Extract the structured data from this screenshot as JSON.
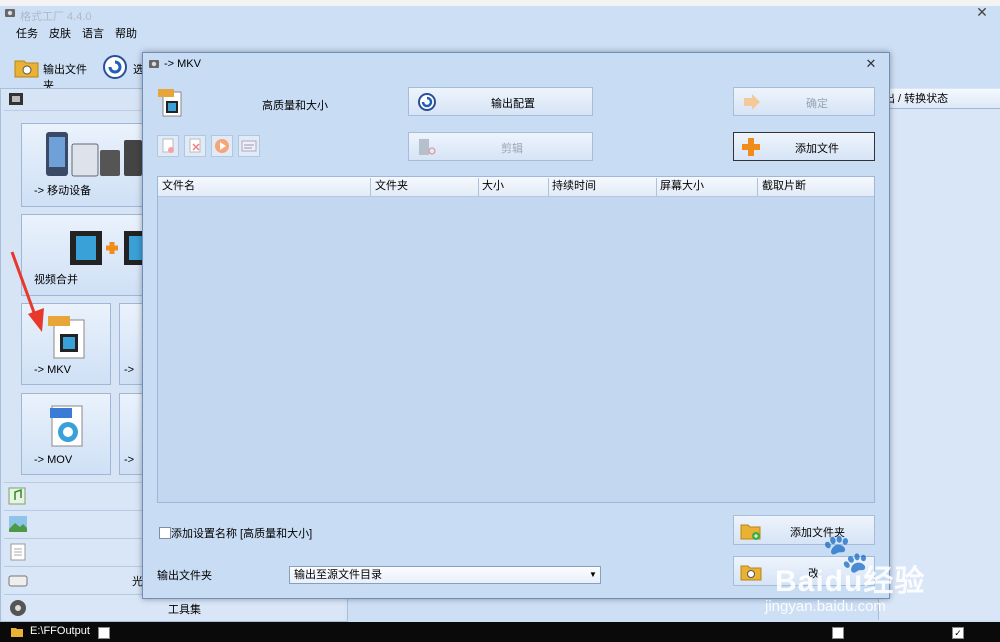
{
  "main": {
    "title": "格式工厂 4.4.0",
    "menu": [
      "任务",
      "皮肤",
      "语言",
      "帮助"
    ],
    "toolbar": {
      "output_folder_label": "输出文件夹",
      "options_label": "选"
    },
    "status_header": "出 / 转换状态"
  },
  "left_panel": {
    "tiles": [
      {
        "label": "-> 移动设备"
      },
      {
        "label": "视频合并"
      },
      {
        "label": "-> MKV"
      },
      {
        "label": "-> MOV"
      },
      {
        "label": "->"
      },
      {
        "label": "->"
      }
    ],
    "categories": [
      "光",
      "工具集"
    ]
  },
  "dialog": {
    "title": "-> MKV",
    "profile_label": "高质量和大小",
    "buttons": {
      "output_config": "输出配置",
      "ok": "确定",
      "clip": "剪辑",
      "add_file": "添加文件",
      "add_folder": "添加文件夹",
      "partial": "改"
    },
    "table_columns": [
      "文件名",
      "文件夹",
      "大小",
      "持续时间",
      "屏幕大小",
      "截取片断"
    ],
    "add_setting_name_label": "添加设置名称 [高质量和大小]",
    "output_folder_label": "输出文件夹",
    "output_folder_value": "输出至源文件目录"
  },
  "statusbar": {
    "path": "E:\\FFOutput"
  },
  "watermark": {
    "logo": "Baidu经验",
    "url": "jingyan.baidu.com"
  },
  "colors": {
    "accent_orange": "#f08c1c",
    "background": "#cddff5",
    "arrow_red": "#e8372b"
  }
}
